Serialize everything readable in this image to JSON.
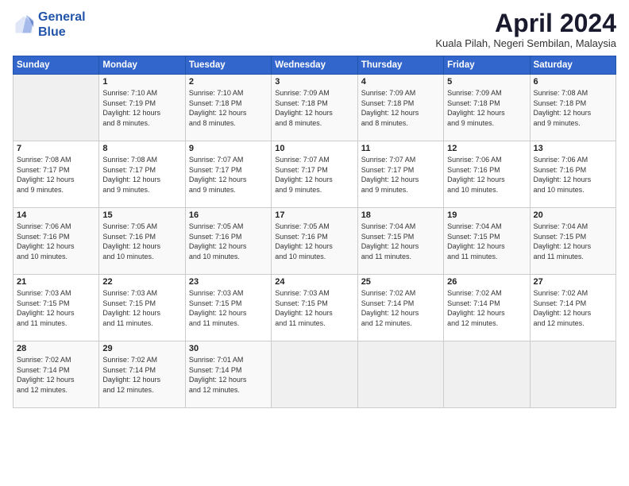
{
  "header": {
    "logo_line1": "General",
    "logo_line2": "Blue",
    "month_title": "April 2024",
    "location": "Kuala Pilah, Negeri Sembilan, Malaysia"
  },
  "weekdays": [
    "Sunday",
    "Monday",
    "Tuesday",
    "Wednesday",
    "Thursday",
    "Friday",
    "Saturday"
  ],
  "weeks": [
    [
      {
        "num": "",
        "info": ""
      },
      {
        "num": "1",
        "info": "Sunrise: 7:10 AM\nSunset: 7:19 PM\nDaylight: 12 hours\nand 8 minutes."
      },
      {
        "num": "2",
        "info": "Sunrise: 7:10 AM\nSunset: 7:18 PM\nDaylight: 12 hours\nand 8 minutes."
      },
      {
        "num": "3",
        "info": "Sunrise: 7:09 AM\nSunset: 7:18 PM\nDaylight: 12 hours\nand 8 minutes."
      },
      {
        "num": "4",
        "info": "Sunrise: 7:09 AM\nSunset: 7:18 PM\nDaylight: 12 hours\nand 8 minutes."
      },
      {
        "num": "5",
        "info": "Sunrise: 7:09 AM\nSunset: 7:18 PM\nDaylight: 12 hours\nand 9 minutes."
      },
      {
        "num": "6",
        "info": "Sunrise: 7:08 AM\nSunset: 7:18 PM\nDaylight: 12 hours\nand 9 minutes."
      }
    ],
    [
      {
        "num": "7",
        "info": "Sunrise: 7:08 AM\nSunset: 7:17 PM\nDaylight: 12 hours\nand 9 minutes."
      },
      {
        "num": "8",
        "info": "Sunrise: 7:08 AM\nSunset: 7:17 PM\nDaylight: 12 hours\nand 9 minutes."
      },
      {
        "num": "9",
        "info": "Sunrise: 7:07 AM\nSunset: 7:17 PM\nDaylight: 12 hours\nand 9 minutes."
      },
      {
        "num": "10",
        "info": "Sunrise: 7:07 AM\nSunset: 7:17 PM\nDaylight: 12 hours\nand 9 minutes."
      },
      {
        "num": "11",
        "info": "Sunrise: 7:07 AM\nSunset: 7:17 PM\nDaylight: 12 hours\nand 9 minutes."
      },
      {
        "num": "12",
        "info": "Sunrise: 7:06 AM\nSunset: 7:16 PM\nDaylight: 12 hours\nand 10 minutes."
      },
      {
        "num": "13",
        "info": "Sunrise: 7:06 AM\nSunset: 7:16 PM\nDaylight: 12 hours\nand 10 minutes."
      }
    ],
    [
      {
        "num": "14",
        "info": "Sunrise: 7:06 AM\nSunset: 7:16 PM\nDaylight: 12 hours\nand 10 minutes."
      },
      {
        "num": "15",
        "info": "Sunrise: 7:05 AM\nSunset: 7:16 PM\nDaylight: 12 hours\nand 10 minutes."
      },
      {
        "num": "16",
        "info": "Sunrise: 7:05 AM\nSunset: 7:16 PM\nDaylight: 12 hours\nand 10 minutes."
      },
      {
        "num": "17",
        "info": "Sunrise: 7:05 AM\nSunset: 7:16 PM\nDaylight: 12 hours\nand 10 minutes."
      },
      {
        "num": "18",
        "info": "Sunrise: 7:04 AM\nSunset: 7:15 PM\nDaylight: 12 hours\nand 11 minutes."
      },
      {
        "num": "19",
        "info": "Sunrise: 7:04 AM\nSunset: 7:15 PM\nDaylight: 12 hours\nand 11 minutes."
      },
      {
        "num": "20",
        "info": "Sunrise: 7:04 AM\nSunset: 7:15 PM\nDaylight: 12 hours\nand 11 minutes."
      }
    ],
    [
      {
        "num": "21",
        "info": "Sunrise: 7:03 AM\nSunset: 7:15 PM\nDaylight: 12 hours\nand 11 minutes."
      },
      {
        "num": "22",
        "info": "Sunrise: 7:03 AM\nSunset: 7:15 PM\nDaylight: 12 hours\nand 11 minutes."
      },
      {
        "num": "23",
        "info": "Sunrise: 7:03 AM\nSunset: 7:15 PM\nDaylight: 12 hours\nand 11 minutes."
      },
      {
        "num": "24",
        "info": "Sunrise: 7:03 AM\nSunset: 7:15 PM\nDaylight: 12 hours\nand 11 minutes."
      },
      {
        "num": "25",
        "info": "Sunrise: 7:02 AM\nSunset: 7:14 PM\nDaylight: 12 hours\nand 12 minutes."
      },
      {
        "num": "26",
        "info": "Sunrise: 7:02 AM\nSunset: 7:14 PM\nDaylight: 12 hours\nand 12 minutes."
      },
      {
        "num": "27",
        "info": "Sunrise: 7:02 AM\nSunset: 7:14 PM\nDaylight: 12 hours\nand 12 minutes."
      }
    ],
    [
      {
        "num": "28",
        "info": "Sunrise: 7:02 AM\nSunset: 7:14 PM\nDaylight: 12 hours\nand 12 minutes."
      },
      {
        "num": "29",
        "info": "Sunrise: 7:02 AM\nSunset: 7:14 PM\nDaylight: 12 hours\nand 12 minutes."
      },
      {
        "num": "30",
        "info": "Sunrise: 7:01 AM\nSunset: 7:14 PM\nDaylight: 12 hours\nand 12 minutes."
      },
      {
        "num": "",
        "info": ""
      },
      {
        "num": "",
        "info": ""
      },
      {
        "num": "",
        "info": ""
      },
      {
        "num": "",
        "info": ""
      }
    ]
  ]
}
